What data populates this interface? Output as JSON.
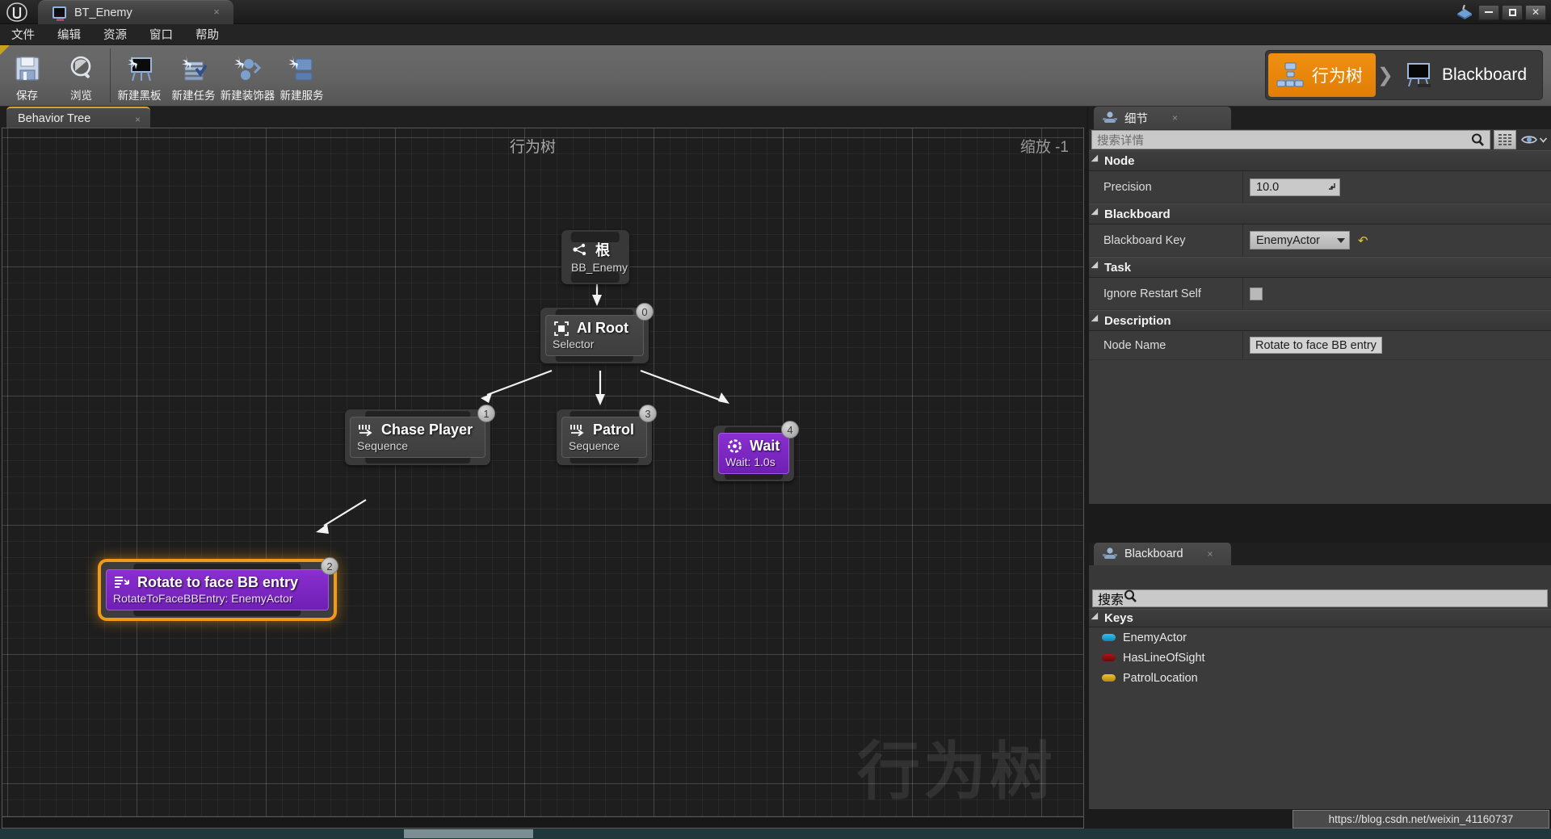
{
  "window": {
    "tab_title": "BT_Enemy",
    "tab_close": "×",
    "minimize": "minimize-icon",
    "restore": "restore-icon",
    "close": "✕"
  },
  "menubar": {
    "items": [
      {
        "label": "文件",
        "name": "menu-file"
      },
      {
        "label": "编辑",
        "name": "menu-edit"
      },
      {
        "label": "资源",
        "name": "menu-assets"
      },
      {
        "label": "窗口",
        "name": "menu-window"
      },
      {
        "label": "帮助",
        "name": "menu-help"
      }
    ]
  },
  "toolbar": {
    "buttons": [
      {
        "label": "保存",
        "icon": "save-icon"
      },
      {
        "label": "浏览",
        "icon": "browse-magnifier-icon"
      },
      {
        "label": "新建黑板",
        "icon": "new-blackboard-icon"
      },
      {
        "label": "新建任务",
        "icon": "new-task-icon"
      },
      {
        "label": "新建装饰器",
        "icon": "new-decorator-icon"
      },
      {
        "label": "新建服务",
        "icon": "new-service-icon"
      }
    ],
    "modes": [
      {
        "label": "行为树",
        "icon": "behavior-tree-icon",
        "active": true
      },
      {
        "label": "Blackboard",
        "icon": "blackboard-easel-icon",
        "active": false
      }
    ],
    "mode_separator": "❯"
  },
  "graph": {
    "tab_label": "Behavior Tree",
    "tab_close": "×",
    "title": "行为树",
    "zoom_label": "缩放 -1",
    "watermark": "行为树",
    "nodes": [
      {
        "id": "root",
        "title": "根",
        "subtitle": "BB_Enemy",
        "badge": "",
        "icon": "root-tree-icon",
        "color": "default",
        "selected": false
      },
      {
        "id": "ai-root",
        "title": "AI Root",
        "subtitle": "Selector",
        "badge": "0",
        "icon": "selector-icon",
        "color": "default",
        "selected": false
      },
      {
        "id": "chase-player",
        "title": "Chase Player",
        "subtitle": "Sequence",
        "badge": "1",
        "icon": "sequence-icon",
        "color": "default",
        "selected": false
      },
      {
        "id": "patrol",
        "title": "Patrol",
        "subtitle": "Sequence",
        "badge": "3",
        "icon": "sequence-icon",
        "color": "default",
        "selected": false
      },
      {
        "id": "wait",
        "title": "Wait",
        "subtitle": "Wait: 1.0s",
        "badge": "4",
        "icon": "wait-clock-icon",
        "color": "purple",
        "selected": false
      },
      {
        "id": "rotate-to-face",
        "title": "Rotate to face BB entry",
        "subtitle": "RotateToFaceBBEntry: EnemyActor",
        "badge": "2",
        "icon": "task-list-icon",
        "color": "purple",
        "selected": true
      }
    ]
  },
  "details": {
    "tab_label": "细节",
    "tab_close": "×",
    "search_placeholder": "搜索详情",
    "categories": [
      {
        "name": "Node",
        "rows": [
          {
            "label": "Precision",
            "value": "10.0",
            "control": "number"
          }
        ]
      },
      {
        "name": "Blackboard",
        "rows": [
          {
            "label": "Blackboard Key",
            "value": "EnemyActor",
            "control": "combo",
            "revert": "↶"
          }
        ]
      },
      {
        "name": "Task",
        "rows": [
          {
            "label": "Ignore Restart Self",
            "value": "",
            "control": "checkbox",
            "checked": false
          }
        ]
      },
      {
        "name": "Description",
        "rows": [
          {
            "label": "Node Name",
            "value": "Rotate to face BB entry",
            "control": "text"
          }
        ]
      }
    ]
  },
  "blackboard": {
    "tab_label": "Blackboard",
    "tab_close": "×",
    "search_placeholder": "搜索",
    "section_label": "Keys",
    "keys": [
      {
        "name": "EnemyActor",
        "color": "#18a8d8"
      },
      {
        "name": "HasLineOfSight",
        "color": "#8e1212"
      },
      {
        "name": "PatrolLocation",
        "color": "#d9a81b"
      }
    ]
  },
  "footer": {
    "url": "https://blog.csdn.net/weixin_41160737"
  },
  "colors": {
    "accent_orange": "#f09010",
    "node_purple": "#7f26c4",
    "selection": "#f09a16",
    "panel_bg": "#3b3b3b",
    "graph_bg": "#1e1e1e"
  }
}
